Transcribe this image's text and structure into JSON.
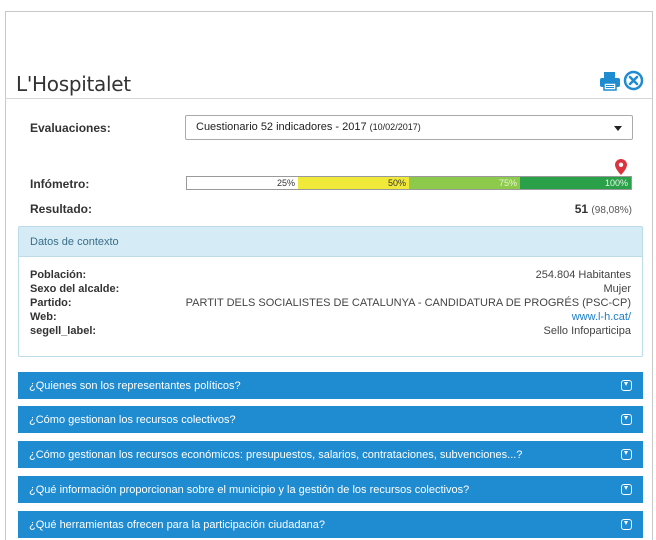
{
  "header": {
    "title": "L'Hospitalet",
    "print_icon": "printer-icon",
    "close_icon": "close-circle-icon",
    "accent": "#1f8bd0"
  },
  "evaluations": {
    "label": "Evaluaciones:",
    "selected_main": "Cuestionario 52 indicadores - 2017",
    "selected_date": "(10/02/2017)"
  },
  "infometer": {
    "label": "Infómetro:",
    "segments": [
      {
        "label": "25%",
        "color": "#ffffff",
        "text_color": "#333333"
      },
      {
        "label": "50%",
        "color": "#f0e93a",
        "text_color": "#333333"
      },
      {
        "label": "75%",
        "color": "#8dca4c",
        "text_color": "#e8f5d8"
      },
      {
        "label": "100%",
        "color": "#2aa149",
        "text_color": "#e8f5e8"
      }
    ],
    "marker_value_pct": 98.08
  },
  "result": {
    "label": "Resultado:",
    "score": "51",
    "pct": "(98,08%)"
  },
  "context": {
    "title": "Datos de contexto",
    "rows": [
      {
        "key": "Población:",
        "value": "254.804 Habitantes",
        "link": false
      },
      {
        "key": "Sexo del alcalde:",
        "value": "Mujer",
        "link": false
      },
      {
        "key": "Partido:",
        "value": "PARTIT DELS SOCIALISTES DE CATALUNYA - CANDIDATURA DE PROGRÉS (PSC-CP)",
        "link": false
      },
      {
        "key": "Web:",
        "value": "www.l-h.cat/",
        "link": true
      },
      {
        "key": "segell_label:",
        "value": "Sello Infoparticipa",
        "link": false
      }
    ]
  },
  "accordion": [
    "¿Quienes son los representantes políticos?",
    "¿Cómo gestionan los recursos colectivos?",
    "¿Cómo gestionan los recursos económicos: presupuestos, salarios, contrataciones, subvenciones...?",
    "¿Qué información proporcionan sobre el municipio y la gestión de los recursos colectivos?",
    "¿Qué herramientas ofrecen para la participación ciudadana?"
  ]
}
